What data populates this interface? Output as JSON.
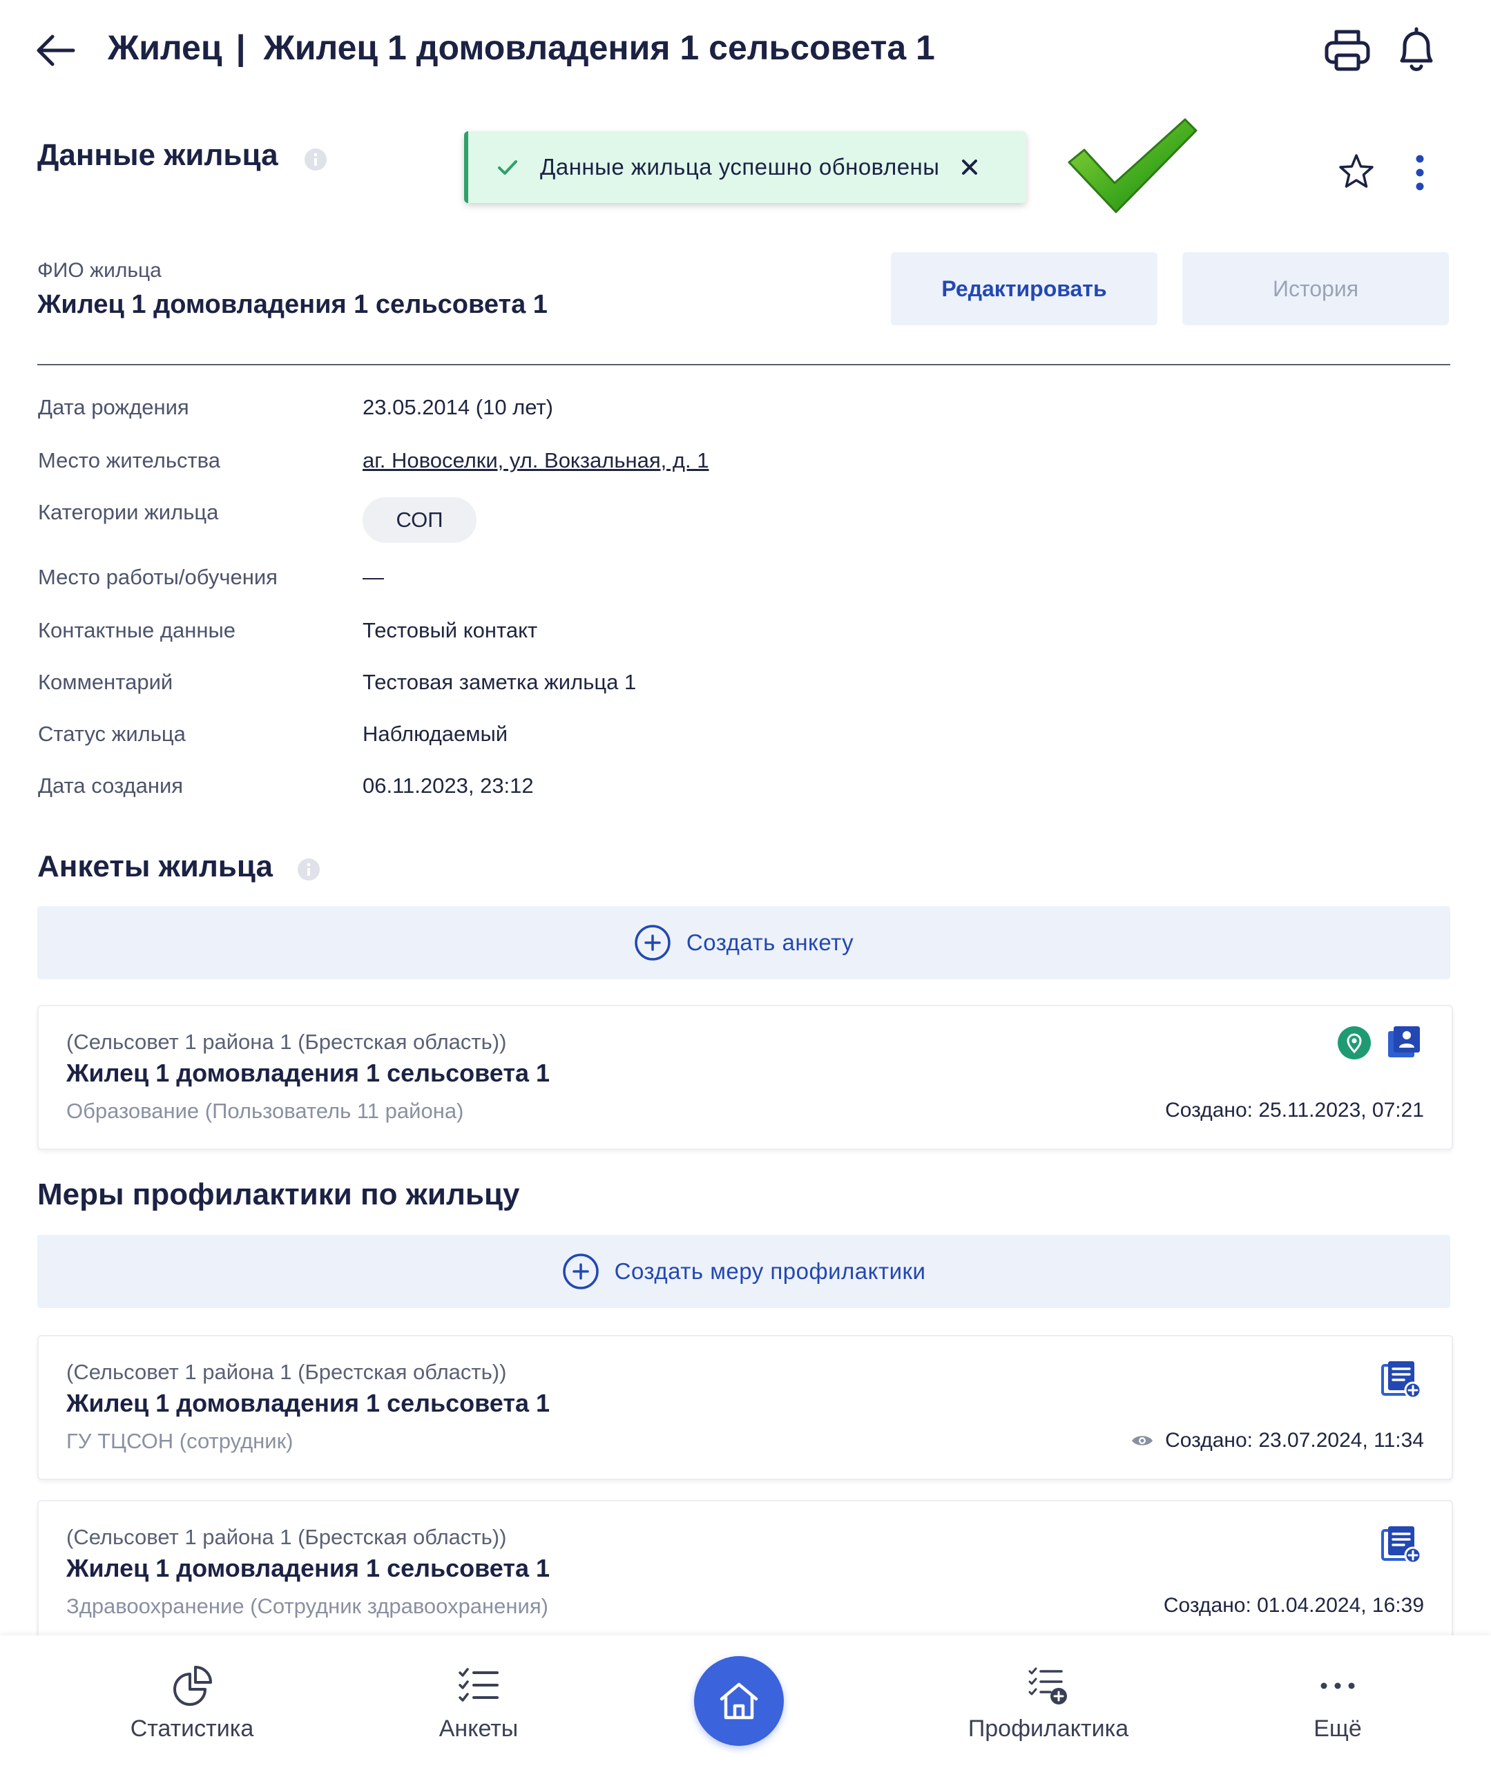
{
  "header": {
    "section": "Жилец",
    "separator": "|",
    "title": "Жилец 1 домовладения 1 сельсовета 1"
  },
  "resident_section": {
    "heading": "Данные жильца"
  },
  "toast": {
    "message": "Данные жильца успешно обновлены"
  },
  "fio": {
    "label": "ФИО жильца",
    "value": "Жилец 1 домовладения 1 сельсовета 1"
  },
  "actions": {
    "edit_label": "Редактировать",
    "history_label": "История"
  },
  "details": {
    "birth": {
      "label": "Дата рождения",
      "value": "23.05.2014 (10 лет)"
    },
    "residence": {
      "label": "Место жительства",
      "value": "аг. Новоселки, ул. Вокзальная, д. 1"
    },
    "categories": {
      "label": "Категории жильца",
      "value": "СОП"
    },
    "work": {
      "label": "Место работы/обучения",
      "value": "—"
    },
    "contacts": {
      "label": "Контактные данные",
      "value": "Тестовый контакт"
    },
    "comment": {
      "label": "Комментарий",
      "value": "Тестовая заметка жильца 1"
    },
    "status": {
      "label": "Статус жильца",
      "value": "Наблюдаемый"
    },
    "created": {
      "label": "Дата создания",
      "value": "06.11.2023, 23:12"
    }
  },
  "forms_section": {
    "heading": "Анкеты жильца",
    "create_label": "Создать анкету",
    "cards": [
      {
        "org": "(Сельсовет 1 района 1 (Брестская область))",
        "name": "Жилец 1 домовладения 1 сельсовета 1",
        "author": "Образование (Пользователь 11 района)",
        "created": "Создано: 25.11.2023, 07:21"
      }
    ]
  },
  "measures_section": {
    "heading": "Меры профилактики по жильцу",
    "create_label": "Создать меру профилактики",
    "cards": [
      {
        "org": "(Сельсовет 1 района 1 (Брестская область))",
        "name": "Жилец 1 домовладения 1 сельсовета 1",
        "author": "ГУ ТЦСОН (сотрудник)",
        "created": "Создано: 23.07.2024, 11:34"
      },
      {
        "org": "(Сельсовет 1 района 1 (Брестская область))",
        "name": "Жилец 1 домовладения 1 сельсовета 1",
        "author": "Здравоохранение (Сотрудник здравоохранения)",
        "created": "Создано: 01.04.2024, 16:39"
      }
    ]
  },
  "bottom_nav": {
    "statistics": "Статистика",
    "forms": "Анкеты",
    "prevention": "Профилактика",
    "more": "Ещё"
  },
  "colors": {
    "primary": "#2348b3",
    "home_button": "#3a63dc",
    "toast_bg": "#dff8ea",
    "toast_accent": "#2fa06a",
    "location_pin": "#1f9b72",
    "button_bg": "#edf2fa"
  },
  "icons": {
    "back": "arrow-left-icon",
    "print": "printer-icon",
    "notifications": "bell-icon",
    "favorite": "star-icon",
    "menu": "kebab-menu-icon",
    "location": "location-pin-icon",
    "contact_card": "contact-card-icon",
    "add_document": "document-add-icon",
    "viewed": "eye-icon",
    "home": "home-icon"
  }
}
